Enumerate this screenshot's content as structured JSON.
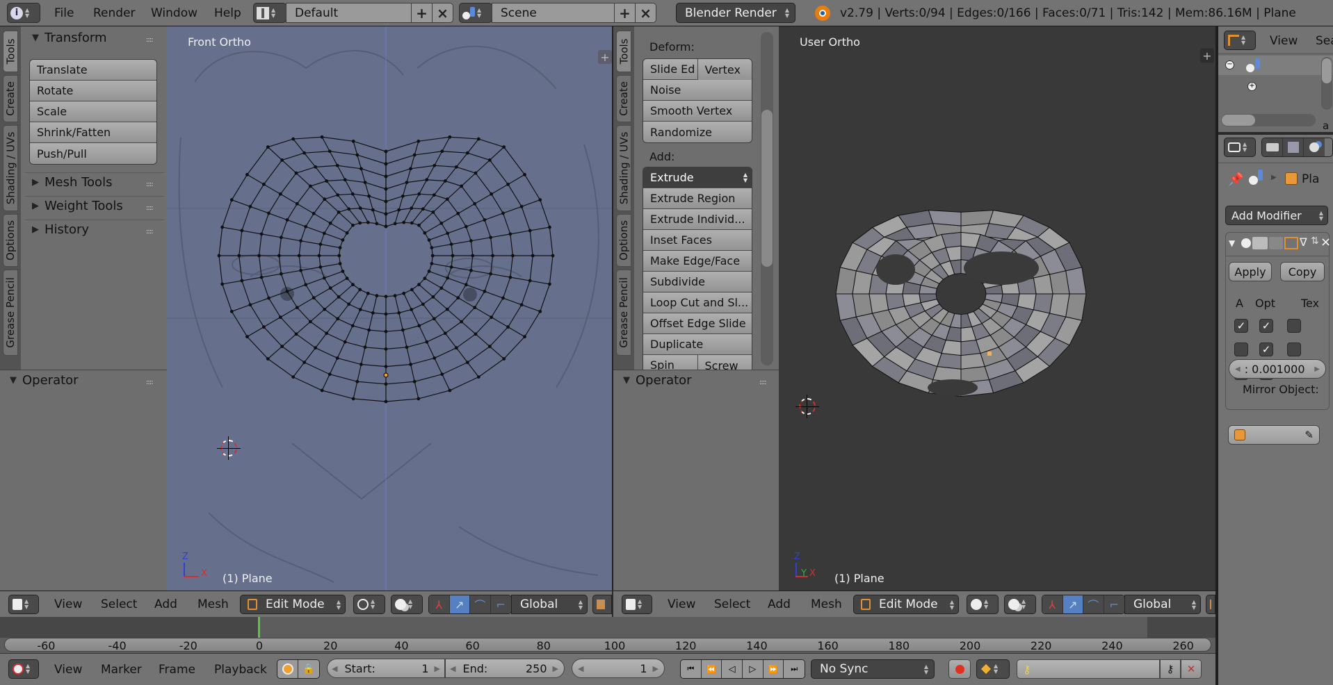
{
  "topbar": {
    "menus": [
      "File",
      "Render",
      "Window",
      "Help"
    ],
    "screen_layout": "Default",
    "scene": "Scene",
    "render_engine": "Blender Render",
    "stats": "v2.79 | Verts:0/94 | Edges:0/166 | Faces:0/71 | Tris:142 | Mem:86.16M | Plane",
    "icons": {
      "info": "info-icon",
      "layout": "layout-icon",
      "scene": "scene-icon",
      "blender": "blender-logo-icon"
    }
  },
  "left_shelf": {
    "tabs": [
      "Tools",
      "Create",
      "Shading / UVs",
      "Options",
      "Grease Pencil"
    ],
    "transform_title": "Transform",
    "transform_buttons": [
      "Translate",
      "Rotate",
      "Scale",
      "Shrink/Fatten",
      "Push/Pull"
    ],
    "collapsed_panels": [
      "Mesh Tools",
      "Weight Tools",
      "History"
    ],
    "operator_title": "Operator"
  },
  "mid_shelf": {
    "tabs": [
      "Tools",
      "Create",
      "Shading / UVs",
      "Options",
      "Grease Pencil"
    ],
    "deform_label": "Deform:",
    "deform_row": [
      "Slide Ed",
      "Vertex"
    ],
    "deform_buttons": [
      "Noise",
      "Smooth Vertex",
      "Randomize"
    ],
    "add_label": "Add:",
    "extrude_select": "Extrude",
    "add_buttons": [
      "Extrude Region",
      "Extrude Individ...",
      "Inset Faces",
      "Make Edge/Face",
      "Subdivide",
      "Loop Cut and Sl...",
      "Offset Edge Slide",
      "Duplicate"
    ],
    "last_row": [
      "Spin",
      "Screw"
    ],
    "operator_title": "Operator"
  },
  "viewport_left": {
    "view_name": "Front Ortho",
    "object_label": "(1) Plane",
    "axis": {
      "up": "Z",
      "right": "X"
    }
  },
  "viewport_right": {
    "view_name": "User Ortho",
    "object_label": "(1) Plane",
    "axis": {
      "up": "Z",
      "mid": "Y",
      "right": "X"
    }
  },
  "viewport_header_left": {
    "menus": [
      "View",
      "Select",
      "Add",
      "Mesh"
    ],
    "mode": "Edit Mode",
    "orientation": "Global"
  },
  "viewport_header_right": {
    "menus": [
      "View",
      "Select",
      "Add",
      "Mesh"
    ],
    "mode": "Edit Mode",
    "orientation": "Global"
  },
  "timeline": {
    "ticks": [
      "-60",
      "-40",
      "-20",
      "0",
      "20",
      "40",
      "60",
      "80",
      "100",
      "120",
      "140",
      "160",
      "180",
      "200",
      "220",
      "240",
      "260"
    ],
    "current_frame": 0,
    "menus": [
      "View",
      "Marker",
      "Frame",
      "Playback"
    ],
    "start_label": "Start:",
    "start_value": "1",
    "end_label": "End:",
    "end_value": "250",
    "frame_value": "1",
    "sync": "No Sync"
  },
  "outliner": {
    "menu_view": "View",
    "menu_search": "Sea",
    "trailing": "a"
  },
  "properties": {
    "object_name": "Pla",
    "add_modifier": "Add Modifier",
    "apply": "Apply",
    "copy": "Copy",
    "col_headers": [
      "A",
      "Opt",
      "Tex"
    ],
    "checkboxes": [
      [
        true,
        true,
        false
      ],
      [
        false,
        true,
        false
      ],
      [
        false,
        true,
        null
      ]
    ],
    "merge_value": ": 0.001000",
    "mirror_object_label": "Mirror Object:"
  },
  "colors": {
    "active_blue": "#5680c2",
    "frame_green": "#5ec440",
    "record_red": "#e03020",
    "key_yellow": "#f0b030"
  }
}
